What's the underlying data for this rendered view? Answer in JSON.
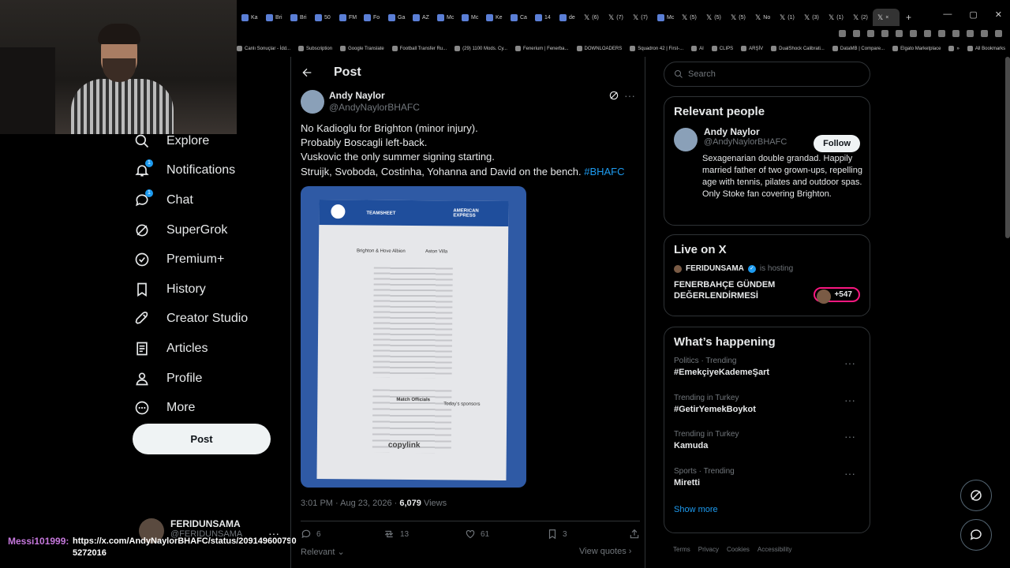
{
  "browser": {
    "tabs": [
      {
        "label": "Ka",
        "type": "site"
      },
      {
        "label": "Bri",
        "type": "site"
      },
      {
        "label": "Bri",
        "type": "site"
      },
      {
        "label": "50",
        "type": "site"
      },
      {
        "label": "FM",
        "type": "site"
      },
      {
        "label": "Fo",
        "type": "site"
      },
      {
        "label": "Ga",
        "type": "site"
      },
      {
        "label": "AZ",
        "type": "site"
      },
      {
        "label": "Mc",
        "type": "site"
      },
      {
        "label": "Mc",
        "type": "site"
      },
      {
        "label": "Ke",
        "type": "site"
      },
      {
        "label": "Ca",
        "type": "site"
      },
      {
        "label": "14",
        "type": "site"
      },
      {
        "label": "de",
        "type": "site"
      },
      {
        "label": "(6)",
        "type": "x"
      },
      {
        "label": "(7)",
        "type": "x"
      },
      {
        "label": "(7)",
        "type": "x"
      },
      {
        "label": "Mc",
        "type": "site"
      },
      {
        "label": "(5)",
        "type": "x"
      },
      {
        "label": "(5)",
        "type": "x"
      },
      {
        "label": "(5)",
        "type": "x"
      },
      {
        "label": "No",
        "type": "x"
      },
      {
        "label": "(1)",
        "type": "x"
      },
      {
        "label": "(3)",
        "type": "x"
      },
      {
        "label": "(1)",
        "type": "x"
      },
      {
        "label": "(2)",
        "type": "x"
      },
      {
        "label": "×",
        "type": "active"
      }
    ],
    "new_tab": "+",
    "bookmarks": [
      "Canlı Sonuçlar - İdd...",
      "Subscription",
      "Google Translate",
      "Football Transfer Ru...",
      "(29) 1100 Mods. Cy...",
      "Fenerium | Fenerba...",
      "DOWNLOADERS",
      "Squadron 42 | First-...",
      "AI",
      "CLIPS",
      "ARŞİV",
      "DualShock Calibrati...",
      "DataMB | Compare...",
      "Elgato Marketplace",
      "»",
      "All Bookmarks"
    ]
  },
  "nav": {
    "items": [
      {
        "label": "Explore",
        "icon": "search-icon"
      },
      {
        "label": "Notifications",
        "icon": "bell-icon",
        "badge": "1"
      },
      {
        "label": "Chat",
        "icon": "chat-icon",
        "badge": "1"
      },
      {
        "label": "SuperGrok",
        "icon": "grok-icon"
      },
      {
        "label": "Premium+",
        "icon": "verified-icon"
      },
      {
        "label": "History",
        "icon": "bookmark-icon"
      },
      {
        "label": "Creator Studio",
        "icon": "rocket-icon"
      },
      {
        "label": "Articles",
        "icon": "article-icon"
      },
      {
        "label": "Profile",
        "icon": "person-icon"
      },
      {
        "label": "More",
        "icon": "more-circle-icon"
      }
    ],
    "post_button": "Post",
    "account": {
      "name": "FERIDUNSAMA",
      "handle": "@FERIDUNSAMA",
      "more": "···"
    }
  },
  "stream_chat": {
    "user": "Messi101999:",
    "message": "https://x.com/AndyNaylorBHAFC/status/209149600790 5272016"
  },
  "post": {
    "header_title": "Post",
    "author": {
      "name": "Andy Naylor",
      "handle": "@AndyNaylorBHAFC"
    },
    "text_lines": [
      "No Kadioglu for Brighton (minor injury).",
      "Probably Boscagli left-back.",
      "Vuskovic the only summer signing starting.",
      "Struijk, Svoboda, Costinha, Yohanna and David on the bench."
    ],
    "hashtag": "#BHAFC",
    "image": {
      "heading": "TEAMSHEET",
      "sponsor": "AMERICAN EXPRESS",
      "home": "Brighton & Hove Albion",
      "away": "Aston Villa",
      "officials": "Match Officials",
      "sponsors": "Today's sponsors",
      "footer_logo": "copylink"
    },
    "time": "3:01 PM · Aug 23, 2026 · ",
    "views": "6,079",
    "views_label": " Views",
    "actions": {
      "replies": "6",
      "reposts": "13",
      "likes": "61",
      "bookmarks": "3"
    },
    "relevant": "Relevant",
    "view_quotes": "View quotes"
  },
  "sidebar": {
    "search_placeholder": "Search",
    "relevant_people": {
      "title": "Relevant people",
      "name": "Andy Naylor",
      "handle": "@AndyNaylorBHAFC",
      "follow": "Follow",
      "bio": "Sexagenarian double grandad. Happily married father of two grown-ups, repelling age with tennis, pilates and outdoor spas. Only Stoke fan covering Brighton."
    },
    "live": {
      "title": "Live on X",
      "host": "FERIDUNSAMA",
      "hosting": "is hosting",
      "topic": "FENERBAHÇE GÜNDEM DEĞERLENDİRMESİ",
      "listeners": "+547"
    },
    "happening": {
      "title": "What’s happening",
      "trends": [
        {
          "category": "Politics · Trending",
          "topic": "#EmekçiyeKademeŞart"
        },
        {
          "category": "Trending in Turkey",
          "topic": "#GetirYemekBoykot"
        },
        {
          "category": "Trending in Turkey",
          "topic": "Kamuda"
        },
        {
          "category": "Sports · Trending",
          "topic": "Miretti"
        }
      ],
      "show_more": "Show more"
    },
    "footer": [
      "Terms",
      "Privacy",
      "Cookies",
      "Accessibility"
    ]
  }
}
